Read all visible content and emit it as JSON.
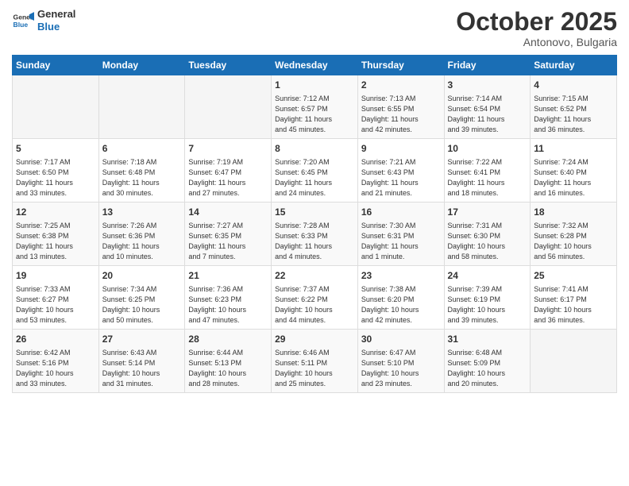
{
  "header": {
    "logo_line1": "General",
    "logo_line2": "Blue",
    "month": "October 2025",
    "location": "Antonovo, Bulgaria"
  },
  "weekdays": [
    "Sunday",
    "Monday",
    "Tuesday",
    "Wednesday",
    "Thursday",
    "Friday",
    "Saturday"
  ],
  "weeks": [
    [
      {
        "day": "",
        "info": ""
      },
      {
        "day": "",
        "info": ""
      },
      {
        "day": "",
        "info": ""
      },
      {
        "day": "1",
        "info": "Sunrise: 7:12 AM\nSunset: 6:57 PM\nDaylight: 11 hours\nand 45 minutes."
      },
      {
        "day": "2",
        "info": "Sunrise: 7:13 AM\nSunset: 6:55 PM\nDaylight: 11 hours\nand 42 minutes."
      },
      {
        "day": "3",
        "info": "Sunrise: 7:14 AM\nSunset: 6:54 PM\nDaylight: 11 hours\nand 39 minutes."
      },
      {
        "day": "4",
        "info": "Sunrise: 7:15 AM\nSunset: 6:52 PM\nDaylight: 11 hours\nand 36 minutes."
      }
    ],
    [
      {
        "day": "5",
        "info": "Sunrise: 7:17 AM\nSunset: 6:50 PM\nDaylight: 11 hours\nand 33 minutes."
      },
      {
        "day": "6",
        "info": "Sunrise: 7:18 AM\nSunset: 6:48 PM\nDaylight: 11 hours\nand 30 minutes."
      },
      {
        "day": "7",
        "info": "Sunrise: 7:19 AM\nSunset: 6:47 PM\nDaylight: 11 hours\nand 27 minutes."
      },
      {
        "day": "8",
        "info": "Sunrise: 7:20 AM\nSunset: 6:45 PM\nDaylight: 11 hours\nand 24 minutes."
      },
      {
        "day": "9",
        "info": "Sunrise: 7:21 AM\nSunset: 6:43 PM\nDaylight: 11 hours\nand 21 minutes."
      },
      {
        "day": "10",
        "info": "Sunrise: 7:22 AM\nSunset: 6:41 PM\nDaylight: 11 hours\nand 18 minutes."
      },
      {
        "day": "11",
        "info": "Sunrise: 7:24 AM\nSunset: 6:40 PM\nDaylight: 11 hours\nand 16 minutes."
      }
    ],
    [
      {
        "day": "12",
        "info": "Sunrise: 7:25 AM\nSunset: 6:38 PM\nDaylight: 11 hours\nand 13 minutes."
      },
      {
        "day": "13",
        "info": "Sunrise: 7:26 AM\nSunset: 6:36 PM\nDaylight: 11 hours\nand 10 minutes."
      },
      {
        "day": "14",
        "info": "Sunrise: 7:27 AM\nSunset: 6:35 PM\nDaylight: 11 hours\nand 7 minutes."
      },
      {
        "day": "15",
        "info": "Sunrise: 7:28 AM\nSunset: 6:33 PM\nDaylight: 11 hours\nand 4 minutes."
      },
      {
        "day": "16",
        "info": "Sunrise: 7:30 AM\nSunset: 6:31 PM\nDaylight: 11 hours\nand 1 minute."
      },
      {
        "day": "17",
        "info": "Sunrise: 7:31 AM\nSunset: 6:30 PM\nDaylight: 10 hours\nand 58 minutes."
      },
      {
        "day": "18",
        "info": "Sunrise: 7:32 AM\nSunset: 6:28 PM\nDaylight: 10 hours\nand 56 minutes."
      }
    ],
    [
      {
        "day": "19",
        "info": "Sunrise: 7:33 AM\nSunset: 6:27 PM\nDaylight: 10 hours\nand 53 minutes."
      },
      {
        "day": "20",
        "info": "Sunrise: 7:34 AM\nSunset: 6:25 PM\nDaylight: 10 hours\nand 50 minutes."
      },
      {
        "day": "21",
        "info": "Sunrise: 7:36 AM\nSunset: 6:23 PM\nDaylight: 10 hours\nand 47 minutes."
      },
      {
        "day": "22",
        "info": "Sunrise: 7:37 AM\nSunset: 6:22 PM\nDaylight: 10 hours\nand 44 minutes."
      },
      {
        "day": "23",
        "info": "Sunrise: 7:38 AM\nSunset: 6:20 PM\nDaylight: 10 hours\nand 42 minutes."
      },
      {
        "day": "24",
        "info": "Sunrise: 7:39 AM\nSunset: 6:19 PM\nDaylight: 10 hours\nand 39 minutes."
      },
      {
        "day": "25",
        "info": "Sunrise: 7:41 AM\nSunset: 6:17 PM\nDaylight: 10 hours\nand 36 minutes."
      }
    ],
    [
      {
        "day": "26",
        "info": "Sunrise: 6:42 AM\nSunset: 5:16 PM\nDaylight: 10 hours\nand 33 minutes."
      },
      {
        "day": "27",
        "info": "Sunrise: 6:43 AM\nSunset: 5:14 PM\nDaylight: 10 hours\nand 31 minutes."
      },
      {
        "day": "28",
        "info": "Sunrise: 6:44 AM\nSunset: 5:13 PM\nDaylight: 10 hours\nand 28 minutes."
      },
      {
        "day": "29",
        "info": "Sunrise: 6:46 AM\nSunset: 5:11 PM\nDaylight: 10 hours\nand 25 minutes."
      },
      {
        "day": "30",
        "info": "Sunrise: 6:47 AM\nSunset: 5:10 PM\nDaylight: 10 hours\nand 23 minutes."
      },
      {
        "day": "31",
        "info": "Sunrise: 6:48 AM\nSunset: 5:09 PM\nDaylight: 10 hours\nand 20 minutes."
      },
      {
        "day": "",
        "info": ""
      }
    ]
  ]
}
